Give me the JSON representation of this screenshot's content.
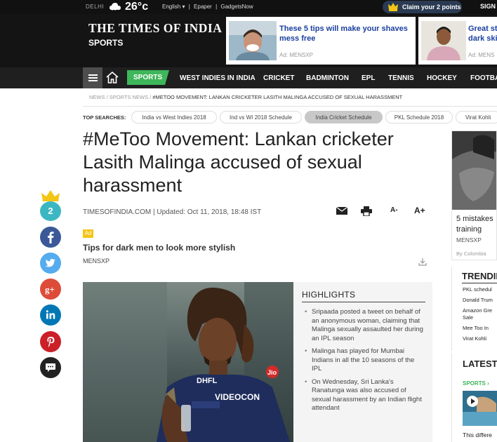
{
  "topbar": {
    "city": "DELHI",
    "weather_icon": "cloud-icon",
    "temperature": "26°c",
    "language": "English ▾",
    "link_epaper": "Epaper",
    "link_gadgets": "GadgetsNow",
    "separator": "|",
    "claim_label": "Claim your 2 points",
    "sign_in": "SIGN"
  },
  "masthead": {
    "logo": "THE TIMES OF INDIA",
    "section": "SPORTS",
    "ads": [
      {
        "title": "These 5 tips will make your shaves mess free",
        "source": "Ad: MENSXP"
      },
      {
        "title": "Great sty dark ski",
        "source": "Ad: MENS"
      }
    ]
  },
  "nav": {
    "active": "SPORTS",
    "items": [
      "WEST INDIES IN INDIA",
      "CRICKET",
      "BADMINTON",
      "EPL",
      "TENNIS",
      "HOCKEY",
      "FOOTBA"
    ]
  },
  "breadcrumb": {
    "crumbs": [
      "NEWS",
      "SPORTS NEWS"
    ],
    "current": "#METOO MOVEMENT: LANKAN CRICKETER LASITH MALINGA ACCUSED OF SEXUAL HARASSMENT",
    "separator": "/"
  },
  "top_searches": {
    "label": "TOP SEARCHES:",
    "items": [
      "India vs West Indies 2018",
      "Ind vs WI 2018 Schedule",
      "India Cricket Schedule",
      "PKL Schedule 2018",
      "Virat Kohli"
    ],
    "active_index": 2
  },
  "article": {
    "headline": "#MeToo Movement: Lankan cricketer Lasith Malinga accused of sexual harassment",
    "byline": "TIMESOFINDIA.COM | Updated: Oct 11, 2018, 18:48 IST",
    "font_small": "A-",
    "font_large": "A+"
  },
  "native_ad": {
    "badge": "Ad",
    "title": "Tips for dark men to look more stylish",
    "source": "MENSXP"
  },
  "highlights": {
    "title": "HIGHLIGHTS",
    "items": [
      "Sripaada posted a tweet on behalf of an anonymous woman, claiming that Malinga sexually assaulted her during an IPL season",
      "Malinga has played for Mumbai Indians in all the 10 seasons of the IPL",
      "On Wednesday, Sri Lanka's Ranatunga was also accused of sexual harassment by an Indian flight attendant"
    ]
  },
  "photo": {
    "jersey_text_1": "DHFL",
    "jersey_text_2": "VIDEOCON",
    "jersey_text_3": "Jio"
  },
  "share": {
    "points_badge": "2",
    "icons": [
      "facebook-icon",
      "twitter-icon",
      "google-plus-icon",
      "linkedin-icon",
      "pinterest-icon",
      "comment-icon"
    ],
    "colors": {
      "points": "#3cb7c2",
      "facebook": "#3b5998",
      "twitter": "#55acee",
      "google": "#dd4b39",
      "linkedin": "#0077b5",
      "pinterest": "#cb2027",
      "comment": "#222222"
    }
  },
  "right_column": {
    "card_title_line1": "5 mistakes",
    "card_title_line2": "training",
    "card_source": "MENSXP",
    "card_by": "By Colombia",
    "trending_title": "TRENDIN",
    "trending_items": [
      "PKL schedul",
      "Donald Trum",
      "Amazon Gre",
      "Sale",
      "Mee Too In",
      "Virat Kohli"
    ],
    "latest_title": "LATEST",
    "latest_section": "SPORTS ›",
    "latest_caption": "This differe"
  },
  "colors": {
    "brand_green": "#3eb65a",
    "masthead_bg": "#141414",
    "nav_bg": "#1f1f1f",
    "ad_link": "#1a3f9f"
  }
}
